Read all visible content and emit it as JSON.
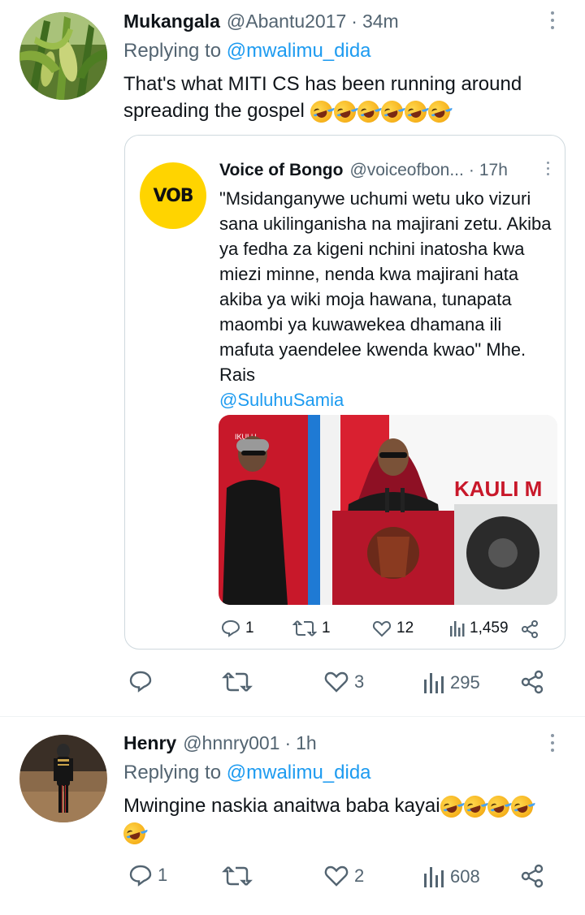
{
  "tweet1": {
    "name": "Mukangala",
    "handle": "@Abantu2017",
    "separator": "·",
    "time": "34m",
    "replying_prefix": "Replying to ",
    "replying_to": "@mwalimu_dida",
    "text_line1": "That's what MITI CS has been running around",
    "text_line2": "spreading the gospel",
    "emoji_count": 6,
    "avatar_icon": "corn-field-avatar",
    "quote": {
      "name": "Voice of Bongo",
      "handle": "@voiceofbon...",
      "separator": "·",
      "time": "17h",
      "avatar_text": "VOB",
      "text": "\"Msidanganywe uchumi wetu uko vizuri sana ukilinganisha na majirani zetu. Akiba ya fedha za kigeni nchini inatosha kwa miezi minne, nenda kwa majirani hata akiba ya wiki moja hawana, tunapata maombi ya kuwawekea dhamana ili mafuta yaendelee kwenda kwao\" Mhe. Rais",
      "mention": "@SuluhuSamia",
      "media_sign_text": "KAULI M",
      "media_banner_text": "IKULU",
      "stats": {
        "replies": "1",
        "retweets": "1",
        "likes": "12",
        "views": "1,459"
      }
    },
    "stats": {
      "replies": "",
      "retweets": "",
      "likes": "3",
      "views": "295"
    }
  },
  "tweet2": {
    "name": "Henry",
    "handle": "@hnnry001",
    "separator": "·",
    "time": "1h",
    "replying_prefix": "Replying to ",
    "replying_to": "@mwalimu_dida",
    "text_line1": "Mwingine naskia anaitwa baba kayai",
    "emoji_count": 5,
    "avatar_icon": "guard-uniform-avatar",
    "stats": {
      "replies": "1",
      "retweets": "",
      "likes": "2",
      "views": "608"
    }
  },
  "colors": {
    "text": "#0f1419",
    "secondary": "#536471",
    "link": "#1d9bf0",
    "border": "#cfd9de",
    "vob_yellow": "#ffd400"
  }
}
